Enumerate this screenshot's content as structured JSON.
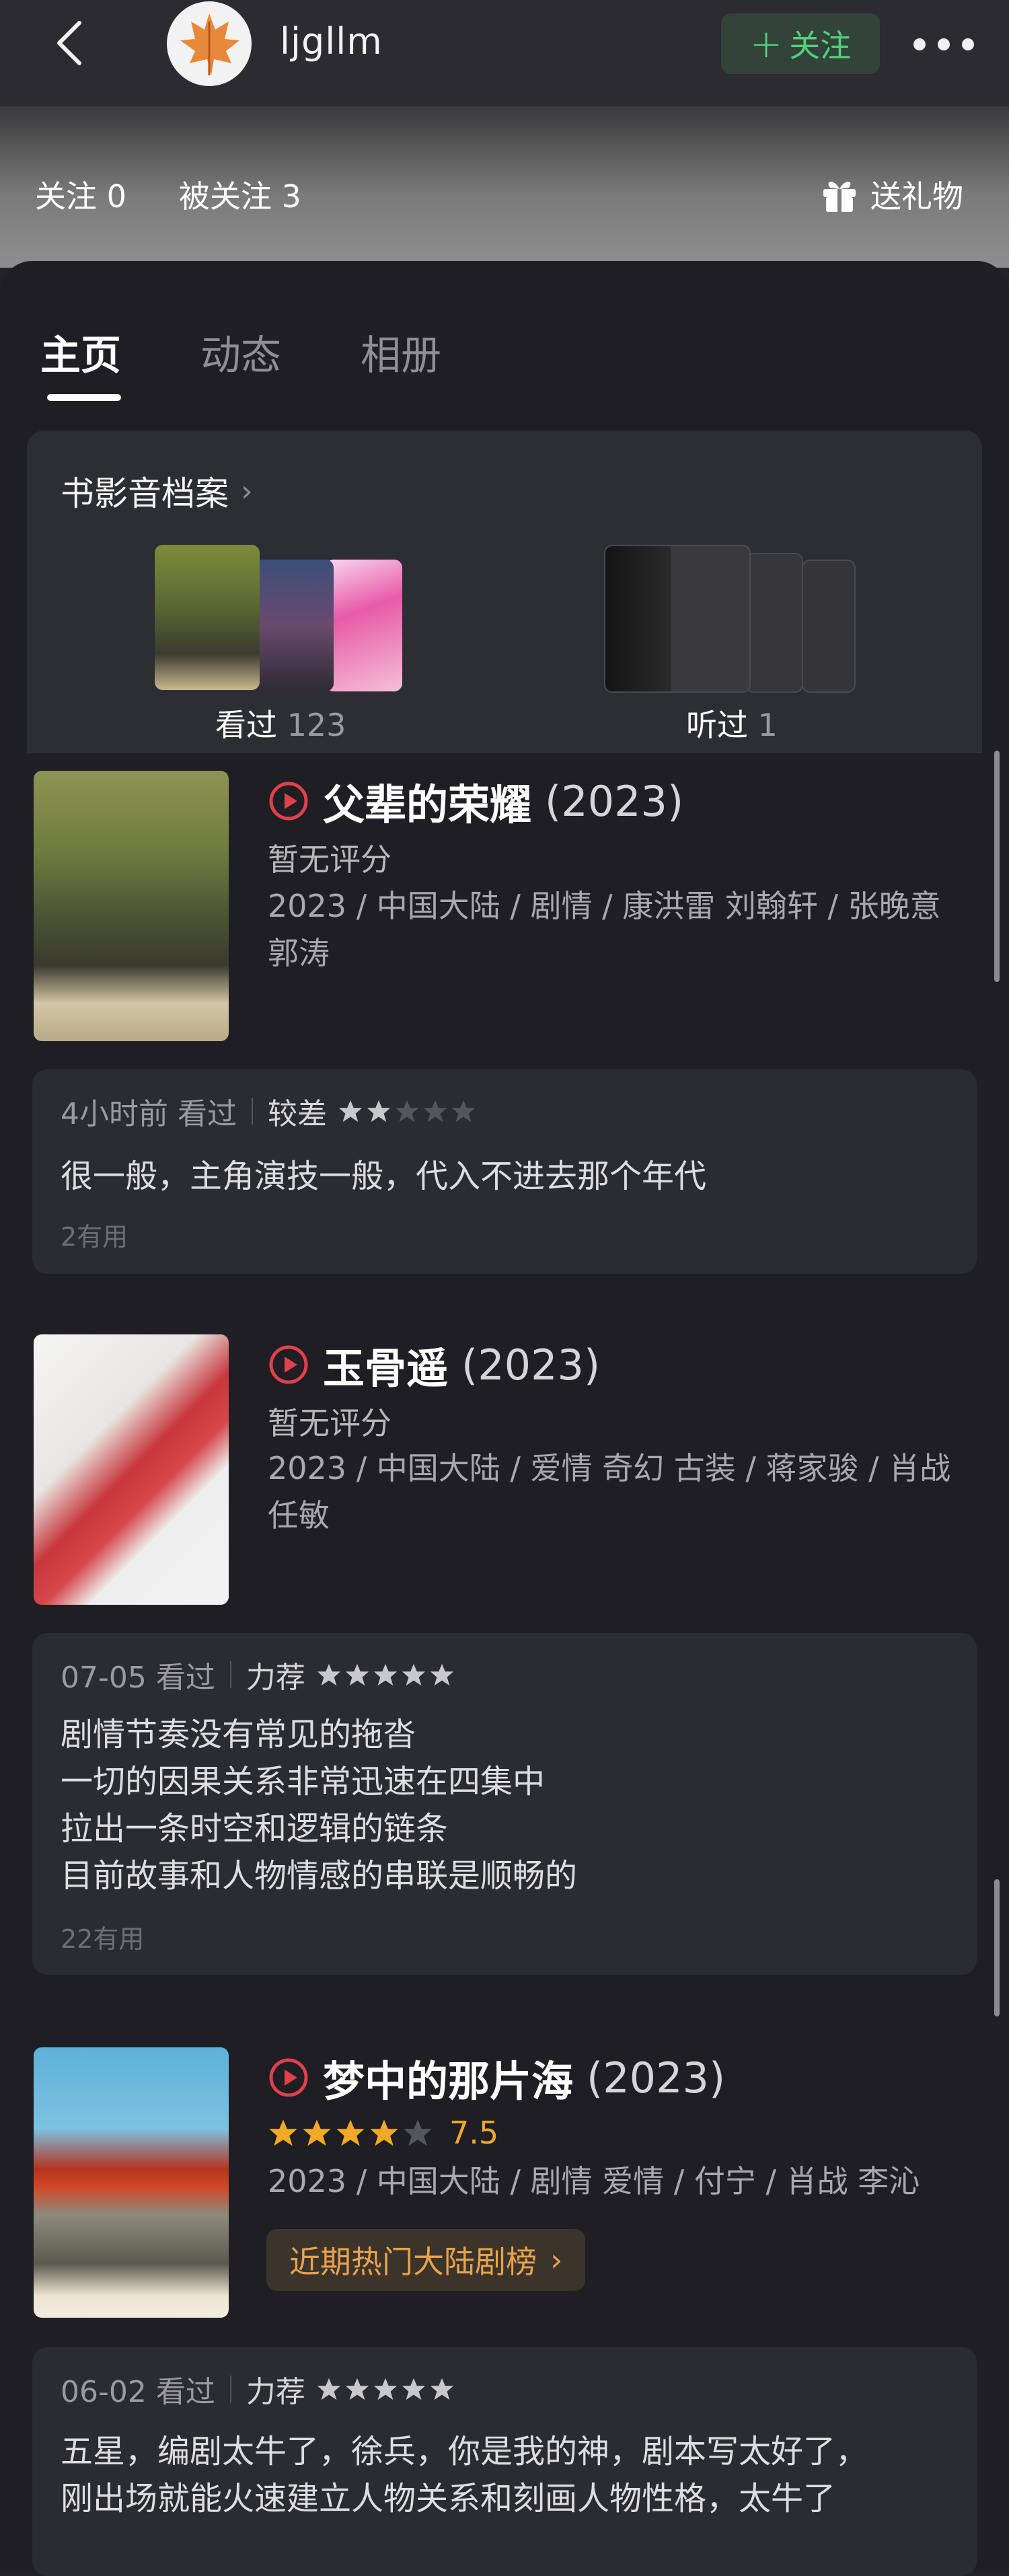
{
  "topbar": {
    "username": "ljgllm",
    "follow_label": "关注",
    "follow_plus": "+"
  },
  "stats": {
    "following": "关注 0",
    "followers": "被关注 3",
    "gift": "送礼物"
  },
  "tabs": [
    {
      "label": "主页"
    },
    {
      "label": "动态"
    },
    {
      "label": "相册"
    }
  ],
  "archive": {
    "title": "书影音档案",
    "watched": {
      "label": "看过",
      "count": "123"
    },
    "listened": {
      "label": "听过",
      "count": "1"
    }
  },
  "items": [
    {
      "title": "父辈的荣耀",
      "year": "(2023)",
      "rating_text": "暂无评分",
      "meta": "2023 / 中国大陆 / 剧情 / 康洪雷 刘翰轩  / 张晚意 郭涛",
      "review": {
        "time": "4小时前 看过",
        "level": "较差",
        "stars": 2,
        "text": "很一般，主角演技一般，代入不进去那个年代",
        "useful": "2有用"
      }
    },
    {
      "title": "玉骨遥",
      "year": "(2023)",
      "rating_text": "暂无评分",
      "meta": "2023 / 中国大陆 / 爱情 奇幻 古装 / 蒋家骏 / 肖战 任敏",
      "review": {
        "time": "07-05 看过",
        "level": "力荐",
        "stars": 5,
        "text": "剧情节奏没有常见的拖沓\n一切的因果关系非常迅速在四集中\n拉出一条时空和逻辑的链条\n目前故事和人物情感的串联是顺畅的",
        "useful": "22有用"
      }
    },
    {
      "title": "梦中的那片海",
      "year": "(2023)",
      "rating_stars": 4,
      "rating_score": "7.5",
      "meta": "2023 / 中国大陆 / 剧情 爱情 / 付宁 / 肖战 李沁",
      "badge": "近期热门大陆剧榜",
      "review": {
        "time": "06-02 看过",
        "level": "力荐",
        "stars": 5,
        "text": "五星，编剧太牛了，徐兵，你是我的神，剧本写太好了，\n刚出场就能火速建立人物关系和刻画人物性格，太牛了"
      }
    }
  ],
  "colors": {
    "accent_green": "#4fd27a",
    "play_red": "#e0414b",
    "star_gold": "#f2a928",
    "badge_orange": "#e9a24d"
  }
}
